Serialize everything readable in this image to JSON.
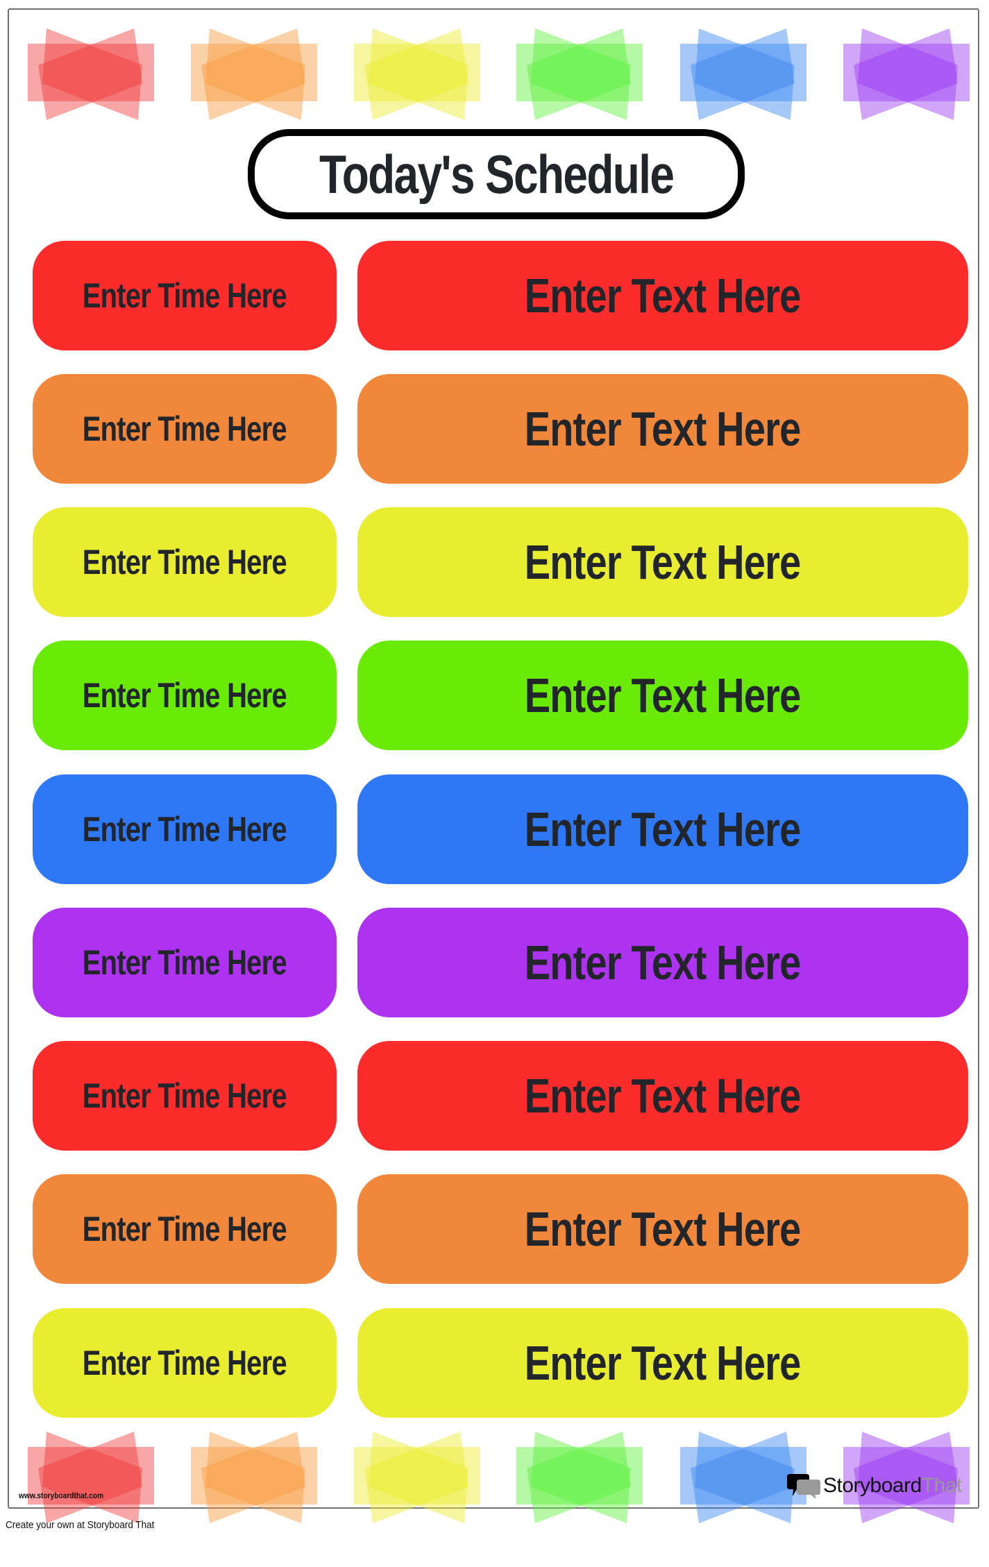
{
  "title": "Today's Schedule",
  "decor_colors": [
    "#f03a3a",
    "#f99a3c",
    "#ecec2c",
    "#5cf03a",
    "#3a86f0",
    "#9a3af0"
  ],
  "rows": [
    {
      "time": "Enter Time Here",
      "text": "Enter Text Here",
      "color": "#fd2c2c"
    },
    {
      "time": "Enter Time Here",
      "text": "Enter Text Here",
      "color": "#f1873a"
    },
    {
      "time": "Enter Time Here",
      "text": "Enter Text Here",
      "color": "#e9ed2f"
    },
    {
      "time": "Enter Time Here",
      "text": "Enter Text Here",
      "color": "#6aeb07"
    },
    {
      "time": "Enter Time Here",
      "text": "Enter Text Here",
      "color": "#2e77f5"
    },
    {
      "time": "Enter Time Here",
      "text": "Enter Text Here",
      "color": "#ae33f0"
    },
    {
      "time": "Enter Time Here",
      "text": "Enter Text Here",
      "color": "#fd2c2c"
    },
    {
      "time": "Enter Time Here",
      "text": "Enter Text Here",
      "color": "#f1873a"
    },
    {
      "time": "Enter Time Here",
      "text": "Enter Text Here",
      "color": "#e9ed2f"
    }
  ],
  "footer": {
    "site_url": "www.storyboardthat.com",
    "brand_primary": "Storyboard",
    "brand_secondary": "That",
    "create_note": "Create your own at Storyboard That"
  }
}
